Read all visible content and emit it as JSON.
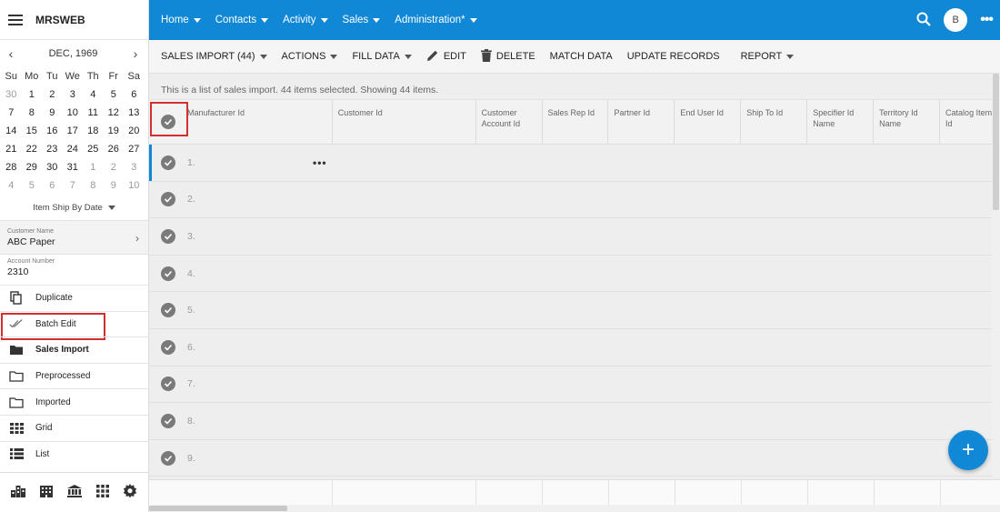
{
  "app": {
    "title": "MRSWEB"
  },
  "calendar": {
    "month_label": "DEC, 1969",
    "prev_glyph": "‹",
    "next_glyph": "›",
    "weekdays": [
      "Su",
      "Mo",
      "Tu",
      "We",
      "Th",
      "Fr",
      "Sa"
    ],
    "weeks": [
      [
        "30",
        "1",
        "2",
        "3",
        "4",
        "5",
        "6"
      ],
      [
        "7",
        "8",
        "9",
        "10",
        "11",
        "12",
        "13"
      ],
      [
        "14",
        "15",
        "16",
        "17",
        "18",
        "19",
        "20"
      ],
      [
        "21",
        "22",
        "23",
        "24",
        "25",
        "26",
        "27"
      ],
      [
        "28",
        "29",
        "30",
        "31",
        "1",
        "2",
        "3"
      ],
      [
        "4",
        "5",
        "6",
        "7",
        "8",
        "9",
        "10"
      ]
    ],
    "filter_label": "Item Ship By Date"
  },
  "customer": {
    "name_label": "Customer Name",
    "name_value": "ABC Paper"
  },
  "account": {
    "number_label": "Account Number",
    "number_value": "2310"
  },
  "menu": {
    "duplicate": "Duplicate",
    "batch_edit": "Batch Edit",
    "sales_import": "Sales Import",
    "preprocessed": "Preprocessed",
    "imported": "Imported",
    "grid": "Grid",
    "list": "List"
  },
  "topnav": {
    "home": "Home",
    "contacts": "Contacts",
    "activity": "Activity",
    "sales": "Sales",
    "administration": "Administration*",
    "avatar_initial": "B"
  },
  "toolbar": {
    "sales_import": "SALES IMPORT (44)",
    "actions": "ACTIONS",
    "fill_data": "FILL DATA",
    "edit": "EDIT",
    "delete": "DELETE",
    "match_data": "MATCH DATA",
    "update_records": "UPDATE RECORDS",
    "report": "REPORT"
  },
  "info_text": "This is a list of sales import. 44 items selected. Showing 44 items.",
  "columns": {
    "manufacturer_id": "Manufacturer Id",
    "customer_id": "Customer Id",
    "customer_account_id": "Customer Account Id",
    "sales_rep_id": "Sales Rep Id",
    "partner_id": "Partner Id",
    "end_user_id": "End User Id",
    "ship_to_id": "Ship To Id",
    "specifier_id_name": "Specifier Id Name",
    "territory_id_name": "Territory Id Name",
    "catalog_item_id": "Catalog Item Id"
  },
  "rows": [
    "1.",
    "2.",
    "3.",
    "4.",
    "5.",
    "6.",
    "7.",
    "8.",
    "9."
  ],
  "row_more_glyph": "•••",
  "fab_glyph": "+",
  "colors": {
    "primary": "#1188d6",
    "highlight": "#d32f2f"
  }
}
